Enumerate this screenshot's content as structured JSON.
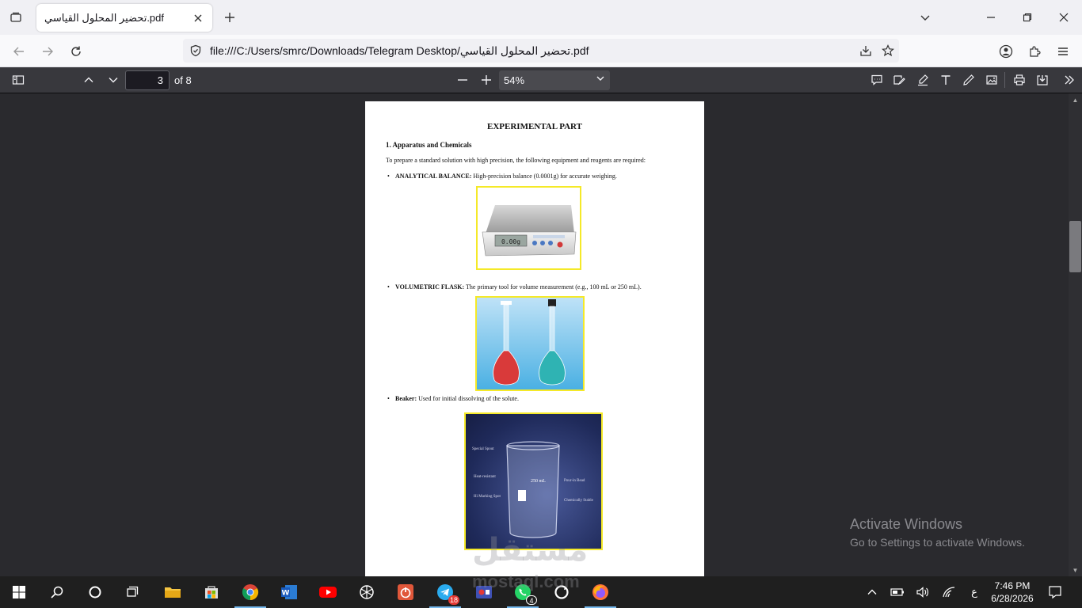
{
  "browser": {
    "tab_title": "تحضير المحلول القياسي.pdf",
    "url": "file:///C:/Users/smrc/Downloads/Telegram Desktop/تحضير المحلول القياسي.pdf"
  },
  "pdf_toolbar": {
    "current_page": "3",
    "page_count_label": "of 8",
    "zoom": "54%"
  },
  "document": {
    "title": "EXPERIMENTAL PART",
    "section_heading": "1. Apparatus and Chemicals",
    "intro": "To prepare a standard solution with high precision, the following equipment and reagents are required:",
    "items": [
      {
        "term": "ANALYTICAL BALANCE:",
        "desc": " High-precision balance (0.0001g) for accurate weighing."
      },
      {
        "term": "VOLUMETRIC FLASK:",
        "desc": " The primary tool for volume measurement (e.g., 100 mL or 250 mL)."
      },
      {
        "term": "Beaker:",
        "desc": " Used for initial dissolving of the solute."
      }
    ],
    "balance_display": "0.00g",
    "beaker_labels": [
      "Special Spout",
      "Heat-resistant",
      "Hi Marking Spot",
      "Pour-in Bead",
      "Chemically Stable",
      "250 mL"
    ]
  },
  "activation": {
    "line1": "Activate Windows",
    "line2": "Go to Settings to activate Windows."
  },
  "watermark": {
    "arabic": "مستقل",
    "latin": "mostaql.com"
  },
  "taskbar": {
    "telegram_badge": "18",
    "whatsapp_badge": "4",
    "ime": "ع",
    "time": "7:46 PM",
    "date": "6/28/2026"
  },
  "colors": {
    "figure_border": "#f5e928",
    "toolbar": "#38383d",
    "viewer_bg": "#2a2a2e"
  }
}
